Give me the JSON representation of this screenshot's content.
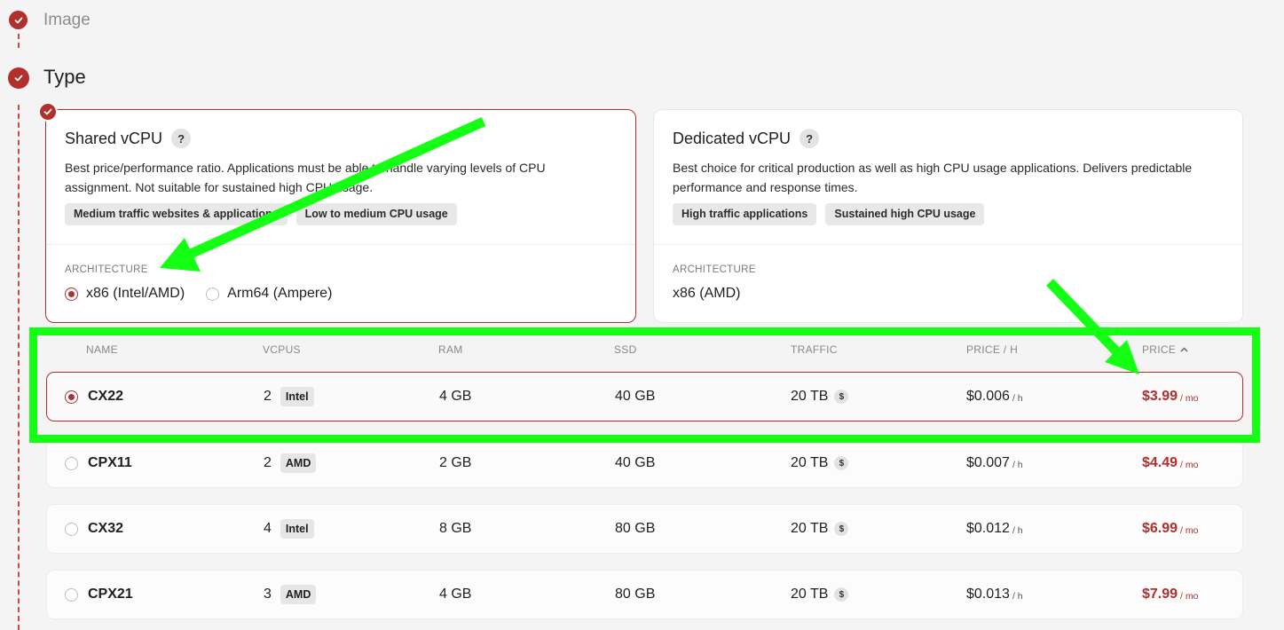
{
  "steps": [
    {
      "label": "Image",
      "state": "done"
    },
    {
      "label": "Type",
      "state": "active"
    }
  ],
  "type_cards": [
    {
      "title": "Shared vCPU",
      "help": "?",
      "description_line1": "Best price/performance ratio. Applications must be able to handle varying levels of CPU",
      "description_line2": "assignment. Not suitable for sustained high CPU usage.",
      "tags": [
        "Medium traffic websites & applications",
        "Low to medium CPU usage"
      ],
      "architecture_label": "ARCHITECTURE",
      "architectures": [
        {
          "label": "x86 (Intel/AMD)",
          "selected": true
        },
        {
          "label": "Arm64 (Ampere)",
          "selected": false
        }
      ],
      "selected": true
    },
    {
      "title": "Dedicated vCPU",
      "help": "?",
      "description_line1": "Best choice for critical production as well as high CPU usage applications. Delivers predictable",
      "description_line2": "performance and response times.",
      "tags": [
        "High traffic applications",
        "Sustained high CPU usage"
      ],
      "architecture_label": "ARCHITECTURE",
      "architecture_value": "x86 (AMD)",
      "selected": false
    }
  ],
  "table": {
    "headers": {
      "name": "NAME",
      "vcpus": "VCPUS",
      "ram": "RAM",
      "ssd": "SSD",
      "traffic": "TRAFFIC",
      "price_h": "PRICE / H",
      "price": "PRICE",
      "sort_icon": "chevron-up-icon"
    },
    "rows": [
      {
        "name": "CX22",
        "vcpus": "2",
        "cpu": "Intel",
        "ram": "4 GB",
        "ssd": "40 GB",
        "traffic": "20 TB",
        "price_h": "$0.006",
        "price_h_unit": "/ h",
        "price": "$3.99",
        "price_unit": "/ mo",
        "selected": true
      },
      {
        "name": "CPX11",
        "vcpus": "2",
        "cpu": "AMD",
        "ram": "2 GB",
        "ssd": "40 GB",
        "traffic": "20 TB",
        "price_h": "$0.007",
        "price_h_unit": "/ h",
        "price": "$4.49",
        "price_unit": "/ mo",
        "selected": false
      },
      {
        "name": "CX32",
        "vcpus": "4",
        "cpu": "Intel",
        "ram": "8 GB",
        "ssd": "80 GB",
        "traffic": "20 TB",
        "price_h": "$0.012",
        "price_h_unit": "/ h",
        "price": "$6.99",
        "price_unit": "/ mo",
        "selected": false
      },
      {
        "name": "CPX21",
        "vcpus": "3",
        "cpu": "AMD",
        "ram": "4 GB",
        "ssd": "80 GB",
        "traffic": "20 TB",
        "price_h": "$0.013",
        "price_h_unit": "/ h",
        "price": "$7.99",
        "price_unit": "/ mo",
        "selected": false
      }
    ],
    "traffic_badge": "$"
  },
  "colors": {
    "accent": "#b22f2c",
    "annotation": "#14ff14",
    "background": "#f4f4f4"
  }
}
